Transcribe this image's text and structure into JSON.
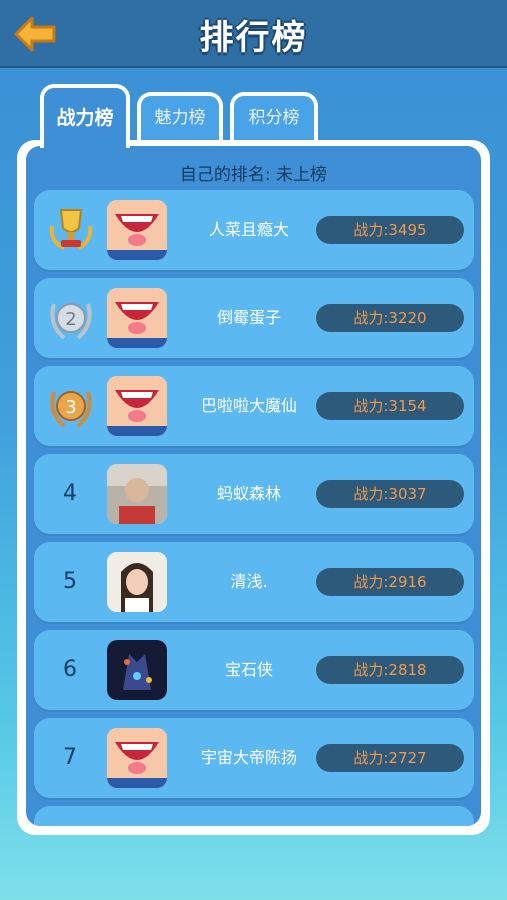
{
  "header": {
    "title": "排行榜"
  },
  "tabs": [
    {
      "label": "战力榜",
      "active": true
    },
    {
      "label": "魅力榜",
      "active": false
    },
    {
      "label": "积分榜",
      "active": false
    }
  ],
  "self_rank": "自己的排名: 未上榜",
  "rows": [
    {
      "rank": "1",
      "name": "人菜且瘾大",
      "power": "战力:3495",
      "avatar": "cartoon-face"
    },
    {
      "rank": "2",
      "name": "倒霉蛋子",
      "power": "战力:3220",
      "avatar": "cartoon-face"
    },
    {
      "rank": "3",
      "name": "巴啦啦大魔仙",
      "power": "战力:3154",
      "avatar": "cartoon-face"
    },
    {
      "rank": "4",
      "name": "蚂蚁森林",
      "power": "战力:3037",
      "avatar": "photo"
    },
    {
      "rank": "5",
      "name": "清浅.",
      "power": "战力:2916",
      "avatar": "photo"
    },
    {
      "rank": "6",
      "name": "宝石侠",
      "power": "战力:2818",
      "avatar": "photo"
    },
    {
      "rank": "7",
      "name": "宇宙大帝陈扬",
      "power": "战力:2727",
      "avatar": "cartoon-face"
    }
  ],
  "colors": {
    "gold": "#e7b53a",
    "silver": "#b9c3cc",
    "bronze": "#d48a38",
    "power_text": "#f39a4a"
  }
}
